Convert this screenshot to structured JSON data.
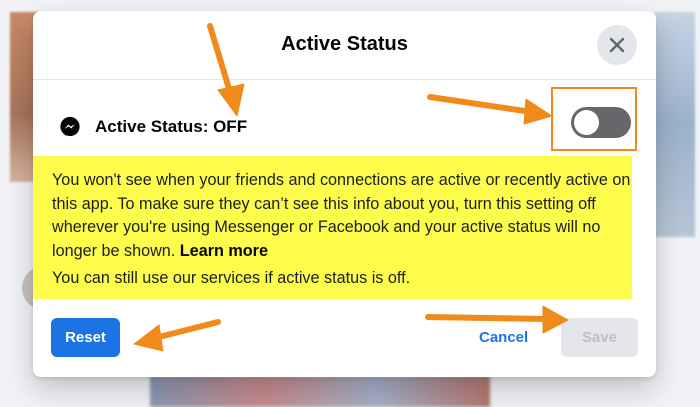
{
  "dialog": {
    "title": "Active Status",
    "close_icon": "close-icon",
    "status_label": "Active Status: OFF",
    "status_icon": "messenger-icon",
    "toggle_state": "off",
    "info_text": "You won't see when your friends and connections are active or recently active on this app. To make sure they can’t see this info about you, turn this setting off wherever you're using Messenger or Facebook and your active status will no longer be shown.",
    "learn_more_label": "Learn more",
    "info_text_2": "You can still use our services if active status is off.",
    "reset_label": "Reset",
    "cancel_label": "Cancel",
    "save_label": "Save"
  },
  "colors": {
    "primary": "#1b74e4",
    "highlight": "#fdfc4a",
    "annotation": "#f08a1b",
    "toggle_off": "#65676b"
  }
}
